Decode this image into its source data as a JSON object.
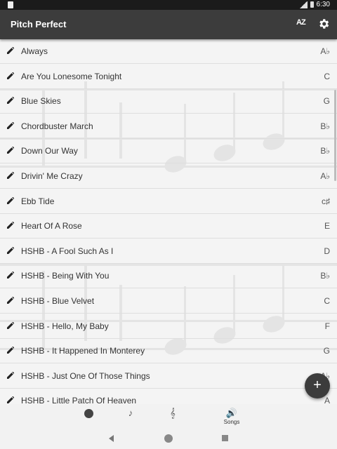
{
  "status_bar": {
    "time": "6:30",
    "network": "LTE"
  },
  "app_bar": {
    "title": "Pitch Perfect",
    "sort_label": "AZ"
  },
  "songs": [
    {
      "title": "Always",
      "key": "A♭"
    },
    {
      "title": "Are You Lonesome Tonight",
      "key": "C"
    },
    {
      "title": "Blue Skies",
      "key": "G"
    },
    {
      "title": "Chordbuster March",
      "key": "B♭"
    },
    {
      "title": "Down Our Way",
      "key": "B♭"
    },
    {
      "title": "Drivin' Me Crazy",
      "key": "A♭"
    },
    {
      "title": "Ebb Tide",
      "key": "c♯"
    },
    {
      "title": "Heart Of A Rose",
      "key": "E"
    },
    {
      "title": "HSHB - A Fool Such As I",
      "key": "D"
    },
    {
      "title": "HSHB - Being With You",
      "key": "B♭"
    },
    {
      "title": "HSHB - Blue Velvet",
      "key": "C"
    },
    {
      "title": "HSHB - Hello, My Baby",
      "key": "F"
    },
    {
      "title": "HSHB - It Happened In Monterey",
      "key": "G"
    },
    {
      "title": "HSHB - Just One Of Those Things",
      "key": "A♭"
    },
    {
      "title": "HSHB - Little Patch Of Heaven",
      "key": "A"
    }
  ],
  "fab": {
    "label": "+"
  },
  "bottom_nav": [
    {
      "icon": "clock-icon",
      "label": ""
    },
    {
      "icon": "note-icon",
      "symbol": "♪",
      "label": ""
    },
    {
      "icon": "treble-clef-icon",
      "symbol": "𝄞",
      "label": ""
    },
    {
      "icon": "speaker-icon",
      "symbol": "🔊",
      "label": "Songs"
    }
  ],
  "colors": {
    "app_bar": "#3c3c3c",
    "background": "#f4f4f4",
    "divider": "#dedede"
  }
}
